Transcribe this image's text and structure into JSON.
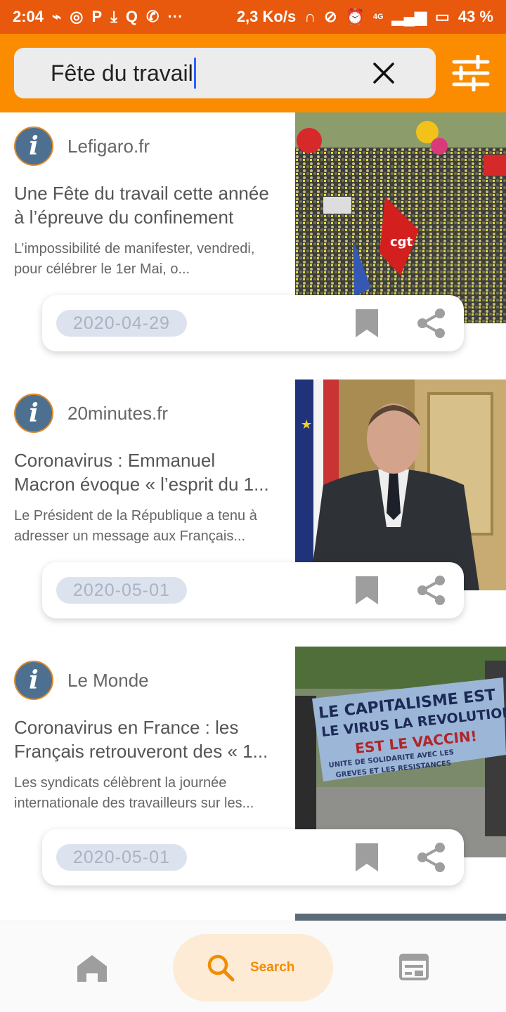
{
  "status_bar": {
    "time": "2:04",
    "speed": "2,3 Ko/s",
    "network": "4G",
    "battery": "43 %"
  },
  "search": {
    "query": "Fête du travail",
    "clear_icon": "close-icon",
    "filter_icon": "tune-icon"
  },
  "articles": [
    {
      "source": "Lefigaro.fr",
      "title": "Une Fête du travail cette année à l’épreuve du confinement",
      "description": "L’impossibilité de manifester, vendredi, pour célébrer le 1er Mai, o...",
      "date": "2020-04-29"
    },
    {
      "source": "20minutes.fr",
      "title": "Coronavirus : Emmanuel Macron évoque « l’esprit du 1...",
      "description": "Le Président de la République a tenu à adresser un message aux Français...",
      "date": "2020-05-01"
    },
    {
      "source": "Le Monde",
      "title": "Coronavirus en France : les Français retrouveront des « 1...",
      "description": "Les syndicats célèbrent la journée internationale des travailleurs sur les...",
      "date": "2020-05-01"
    }
  ],
  "banner_text": {
    "line1": "LE CAPITALISME EST",
    "line2": "LE VIRUS LA REVOLUTION",
    "line3": "EST LE VACCIN!",
    "line4": "UNITE DE SOLIDARITE AVEC LES",
    "line5": "GREVES ET LES RESISTANCES"
  },
  "flag_text": "cgt",
  "bottom_nav": {
    "home_icon": "home-icon",
    "search_label": "Search",
    "news_icon": "newspaper-icon"
  },
  "colors": {
    "status_bar": "#e8580d",
    "top_bar": "#fb8c00",
    "accent": "#f28c00",
    "date_chip": "#dde3ee"
  }
}
